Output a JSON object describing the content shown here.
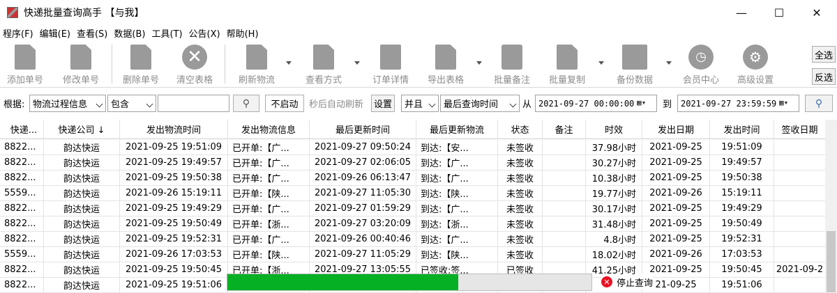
{
  "window": {
    "title": "快递批量查询高手 【与我】",
    "minimize": "—",
    "maximize": "☐",
    "close": "✕"
  },
  "menu": [
    "程序(F)",
    "编辑(E)",
    "查看(S)",
    "数据(B)",
    "工具(T)",
    "公告(X)",
    "帮助(H)"
  ],
  "toolbar": {
    "add": "添加单号",
    "edit": "修改单号",
    "delete": "删除单号",
    "clear": "清空表格",
    "refresh": "刷新物流",
    "view_mode": "查看方式",
    "order_detail": "订单详情",
    "export": "导出表格",
    "batch_note": "批量备注",
    "batch_copy": "批量复制",
    "backup": "备份数据",
    "member": "会员中心",
    "advanced": "高级设置",
    "select_all": "全选",
    "invert": "反选"
  },
  "filter": {
    "label": "根据:",
    "field": "物流过程信息",
    "op": "包含",
    "keyword": "",
    "search_icon": "search-icon",
    "auto_toggle": "不启动",
    "auto_text": "秒后自动刷新",
    "settings": "设置",
    "logic": "并且",
    "time_field": "最后查询时间",
    "from_label": "从",
    "from_value": "2021-09-27 00:00:00",
    "to_label": "到",
    "to_value": "2021-09-27 23:59:59"
  },
  "table": {
    "headers": [
      "快递...",
      "快递公司 ↓",
      "发出物流时间",
      "发出物流信息",
      "最后更新时间",
      "最后更新物流",
      "状态",
      "备注",
      "时效",
      "发出日期",
      "发出时间",
      "签收日期"
    ],
    "rows": [
      [
        "8822...",
        "韵达快运",
        "2021-09-25 19:51:09",
        "已开单:【广...",
        "2021-09-27 09:50:24",
        "到达:【安...",
        "未签收",
        "",
        "37.98小时",
        "2021-09-25",
        "19:51:09",
        ""
      ],
      [
        "8822...",
        "韵达快运",
        "2021-09-25 19:49:57",
        "已开单:【广...",
        "2021-09-27 02:06:05",
        "到达:【广...",
        "未签收",
        "",
        "30.27小时",
        "2021-09-25",
        "19:49:57",
        ""
      ],
      [
        "8822...",
        "韵达快运",
        "2021-09-25 19:50:38",
        "已开单:【广...",
        "2021-09-26 06:13:47",
        "到达:【广...",
        "未签收",
        "",
        "10.38小时",
        "2021-09-25",
        "19:50:38",
        ""
      ],
      [
        "5559...",
        "韵达快运",
        "2021-09-26 15:19:11",
        "已开单:【陕...",
        "2021-09-27 11:05:30",
        "到达:【陕...",
        "未签收",
        "",
        "19.77小时",
        "2021-09-26",
        "15:19:11",
        ""
      ],
      [
        "8822...",
        "韵达快运",
        "2021-09-25 19:49:29",
        "已开单:【广...",
        "2021-09-27 01:59:29",
        "到达:【广...",
        "未签收",
        "",
        "30.17小时",
        "2021-09-25",
        "19:49:29",
        ""
      ],
      [
        "8822...",
        "韵达快运",
        "2021-09-25 19:50:49",
        "已开单:【浙...",
        "2021-09-27 03:20:09",
        "到达:【浙...",
        "未签收",
        "",
        "31.48小时",
        "2021-09-25",
        "19:50:49",
        ""
      ],
      [
        "8822...",
        "韵达快运",
        "2021-09-25 19:52:31",
        "已开单:【广...",
        "2021-09-26 00:40:46",
        "到达:【广...",
        "未签收",
        "",
        "4.8小时",
        "2021-09-25",
        "19:52:31",
        ""
      ],
      [
        "5559...",
        "韵达快运",
        "2021-09-26 17:03:53",
        "已开单:【陕...",
        "2021-09-27 11:05:29",
        "到达:【陕...",
        "未签收",
        "",
        "18.02小时",
        "2021-09-26",
        "17:03:53",
        ""
      ],
      [
        "8822...",
        "韵达快运",
        "2021-09-25 19:50:45",
        "已开单:【浙...",
        "2021-09-27 13:05:55",
        "已签收:签...",
        "已签收",
        "",
        "41.25小时",
        "2021-09-25",
        "19:50:45",
        "2021-09-2"
      ],
      [
        "8822...",
        "韵达快运",
        "2021-09-25 19:51:06",
        "",
        "",
        "",
        "",
        "",
        "5",
        "21-09-25",
        "19:51:06",
        ""
      ]
    ]
  },
  "progress": {
    "fraction": 0.635
  },
  "stop_button": "停止查询"
}
